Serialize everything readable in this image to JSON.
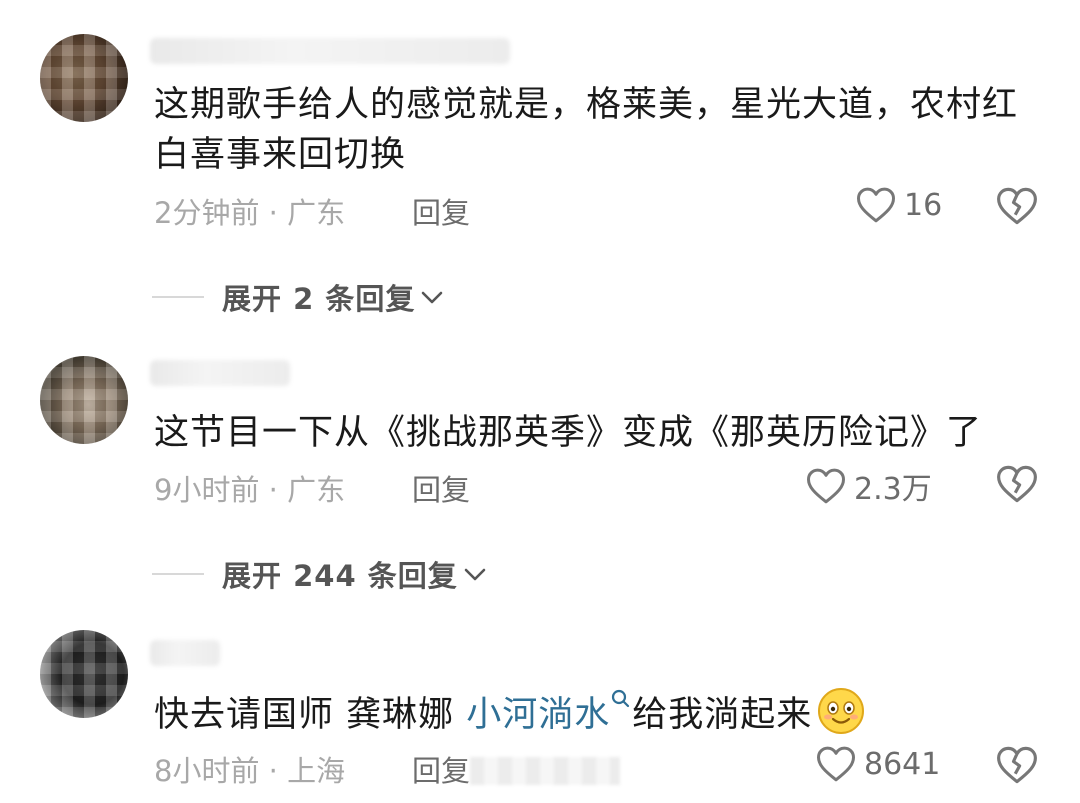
{
  "comments": [
    {
      "text": "这期歌手给人的感觉就是，格莱美，星光大道，农村红白喜事来回切换",
      "meta": "2分钟前 · 广东",
      "reply_label": "回复",
      "likes": "16",
      "expand_label": "展开 2 条回复"
    },
    {
      "text": "这节目一下从《挑战那英季》变成《那英历险记》了",
      "meta": "9小时前 · 广东",
      "reply_label": "回复",
      "likes": "2.3万",
      "expand_label": "展开 244 条回复"
    },
    {
      "text_before": "快去请国师 龚琳娜 ",
      "mention": "小河淌水",
      "text_after": "给我淌起来",
      "meta": "8小时前 · 上海",
      "reply_label": "回复",
      "likes": "8641"
    }
  ],
  "icons": {
    "like": "heart-outline-icon",
    "dislike": "broken-heart-icon",
    "expand": "chevron-down-icon",
    "mention": "search-icon",
    "emoji": "smiling-face-emoji"
  },
  "colors": {
    "text": "#1a1a1a",
    "meta": "#a8a8a8",
    "mention": "#2f6f95"
  }
}
